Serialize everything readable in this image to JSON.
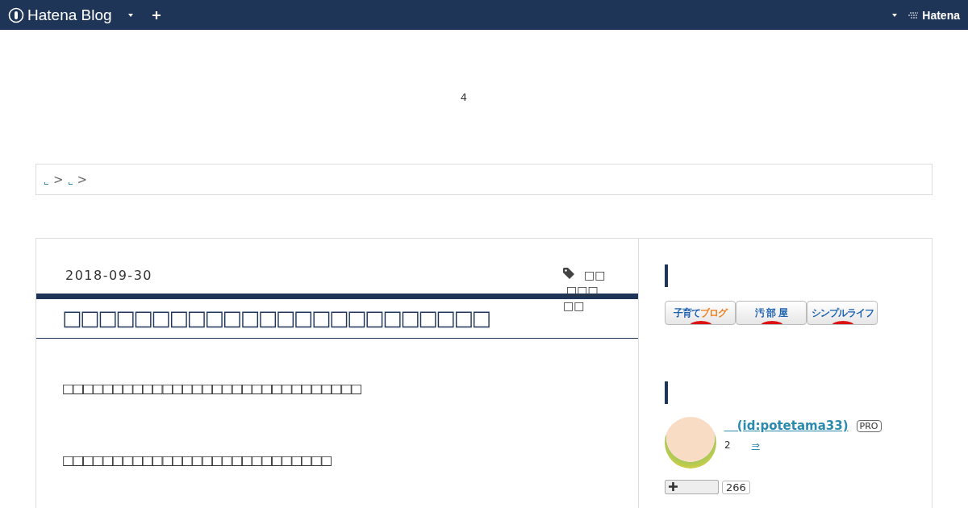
{
  "header": {
    "logo": "Hatena Blog",
    "right_logo": "Hatena"
  },
  "ad_area": {
    "text": "4"
  },
  "breadcrumb": {
    "separators": [
      ">",
      ">"
    ]
  },
  "article": {
    "date": "2018-09-30",
    "tags": [
      "□□",
      "□□□",
      "□□"
    ],
    "title": "□□□□□□□□□□□□□□□□□□□□□□□□",
    "paragraphs": [
      "□□□□□□□□□□□□□□□□□□□□□□□□□□□□□□",
      "□□□□□□□□□□□□□□□□□□□□□□□□□□□"
    ]
  },
  "sidebar": {
    "banners": [
      {
        "parts": [
          "子育て",
          "ブログ"
        ]
      },
      {
        "parts": [
          "汚 部 屋"
        ]
      },
      {
        "parts": [
          "シンプルライフ"
        ]
      }
    ],
    "profile": {
      "name": "   (id:potetama33)",
      "badge": "PRO",
      "count": "2",
      "link": "⇒",
      "follow_count": "266"
    }
  }
}
